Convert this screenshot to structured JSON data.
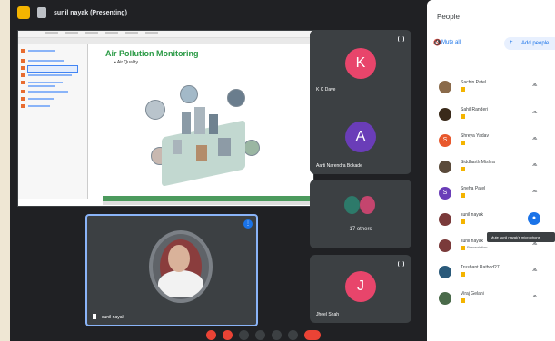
{
  "presenter_bar": {
    "label": "sunil nayak (Presenting)"
  },
  "slide": {
    "title": "Air Pollution Monitoring",
    "bullet": "▪ Air Quality"
  },
  "tiles": [
    {
      "initial": "K",
      "name": "K C Dave",
      "color": "#e8456b"
    },
    {
      "initial": "A",
      "name": "Aarti Narendra Bokade",
      "color": "#6a3db8"
    },
    {
      "initial": "",
      "name": "17 others",
      "color": ""
    },
    {
      "initial": "J",
      "name": "Jheel Shah",
      "color": "#e8456b"
    }
  ],
  "self_tile": {
    "name": "sunil nayak"
  },
  "people": {
    "title": "People",
    "close": "×",
    "mute_all": "Mute all",
    "add_people": "Add people",
    "rows": [
      {
        "name": "Sachin Patel",
        "sub": "",
        "color": "#8a6a4a",
        "initial": ""
      },
      {
        "name": "Sahil Randeri",
        "sub": "",
        "color": "#3a2a1a",
        "initial": ""
      },
      {
        "name": "Shreya Yadav",
        "sub": "",
        "color": "#e8582c",
        "initial": "S"
      },
      {
        "name": "Siddharth Mishra",
        "sub": "",
        "color": "#5a4a3a",
        "initial": ""
      },
      {
        "name": "Sneha Patel",
        "sub": "",
        "color": "#6a3db8",
        "initial": "S"
      },
      {
        "name": "sunil nayak",
        "sub": "",
        "color": "#7a3a3a",
        "initial": ""
      },
      {
        "name": "sunil nayak",
        "sub": "Presentation",
        "color": "#7a3a3a",
        "initial": ""
      },
      {
        "name": "Trushant Rathod27",
        "sub": "",
        "color": "#2a5a7a",
        "initial": ""
      },
      {
        "name": "Viraj Gelani",
        "sub": "",
        "color": "#4a6a4a",
        "initial": ""
      }
    ],
    "tooltip": "Mute sunil nayak's microphone"
  }
}
